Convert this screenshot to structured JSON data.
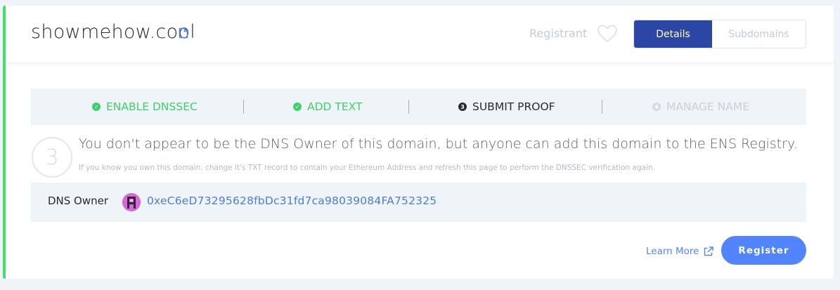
{
  "header": {
    "domain": "showmehow.cool",
    "registrant_label": "Registrant",
    "tabs": [
      {
        "label": "Details",
        "active": true
      },
      {
        "label": "Subdomains",
        "active": false
      }
    ]
  },
  "steps": [
    {
      "label": "ENABLE DNSSEC",
      "status": "done"
    },
    {
      "label": "ADD TEXT",
      "status": "done"
    },
    {
      "label": "SUBMIT PROOF",
      "status": "current",
      "number": "3"
    },
    {
      "label": "MANAGE NAME",
      "status": "pending",
      "number": "4"
    }
  ],
  "submit": {
    "step_number": "3",
    "message": "You don't appear to be the DNS Owner of this domain, but anyone can add this domain to the ENS Registry.",
    "submessage": "If you know you own this domain, change it's TXT record to contain your Ethereum Address and refresh this page to perform the DNSSEC verification again."
  },
  "owner": {
    "label": "DNS Owner",
    "address": "0xeC6eD73295628fbDc31fd7ca98039084FA752325"
  },
  "actions": {
    "learn_more": "Learn More",
    "register": "Register"
  },
  "colors": {
    "accent_green": "#42e068",
    "primary_blue": "#2c46a6",
    "button_blue": "#5284ff",
    "link_blue": "#4a7de0"
  }
}
